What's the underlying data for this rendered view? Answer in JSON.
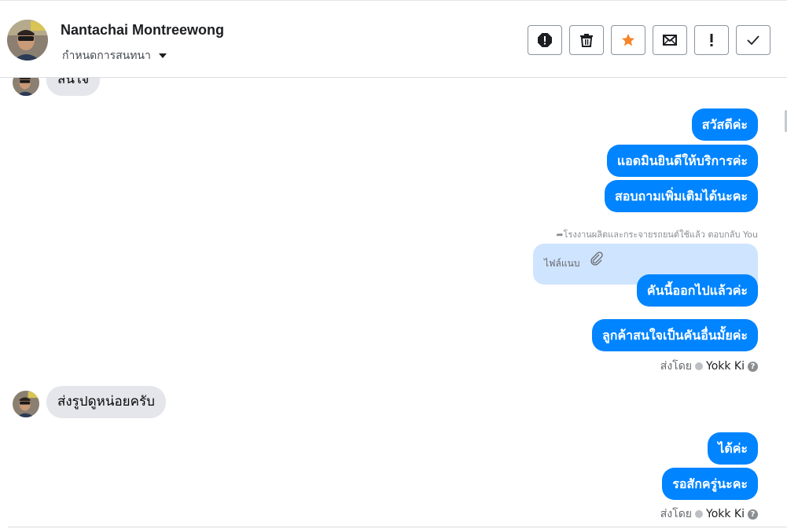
{
  "header": {
    "contact_name": "Nantachai Montreewong",
    "conversation_settings": "กำหนดการสนทนา"
  },
  "actions": [
    {
      "name": "report",
      "icon": "alert-circle-icon"
    },
    {
      "name": "delete",
      "icon": "trash-icon"
    },
    {
      "name": "star",
      "icon": "star-icon"
    },
    {
      "name": "mark-unread",
      "icon": "envelope-icon"
    },
    {
      "name": "important",
      "icon": "exclamation-icon"
    },
    {
      "name": "done",
      "icon": "check-icon"
    }
  ],
  "colors": {
    "outgoing_bubble": "#0084ff",
    "incoming_bubble": "#e4e6eb",
    "attachment_bg": "#cfe4ff",
    "star": "#f5862b"
  },
  "messages": {
    "incoming_0": "สนใจ",
    "out_1": "สวัสดีค่ะ",
    "out_2": "แอดมินยินดีให้บริการค่ะ",
    "out_3": "สอบถามเพิ่มเติมได้นะคะ",
    "reply_meta": "โรงงานผลิตและกระจายรถยนต์ใช้แล้ว ตอบกลับ You",
    "attachment_label": "ไฟล์แนบ",
    "out_4": "คันนี้ออกไปแล้วค่ะ",
    "out_5": "ลูกค้าสนใจเป็นคันอื่นมั้ยค่ะ",
    "sent_by_label": "ส่งโดย",
    "sent_by_name": "Yokk Ki",
    "help": "?",
    "incoming_1": "ส่งรูปดูหน่อยครับ",
    "out_6": "ได้ค่ะ",
    "out_7": "รอสักครู่นะคะ"
  }
}
